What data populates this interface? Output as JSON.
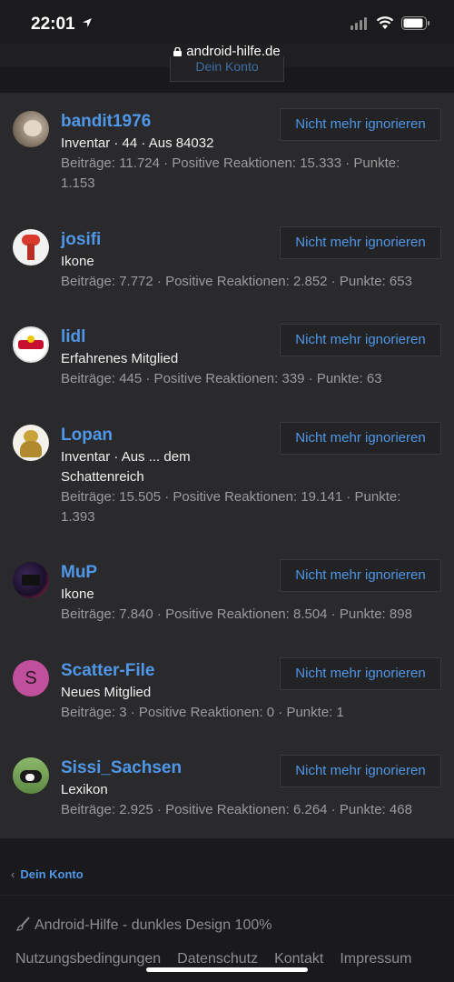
{
  "status_bar": {
    "time": "22:01",
    "url": "android-hilfe.de"
  },
  "top_button": {
    "label": "Dein Konto"
  },
  "ignore_label": "Nicht mehr ignorieren",
  "members": [
    {
      "name": "bandit1976",
      "title": "Inventar · 44 · Aus 84032",
      "stats": "Beiträge: 11.724 · Positive Reaktionen: 15.333 · Punkte: 1.153",
      "avatar": "photo-avatar"
    },
    {
      "name": "josifi",
      "title": "Ikone",
      "stats": "Beiträge: 7.772 · Positive Reaktionen: 2.852 · Punkte: 653",
      "avatar": "photo-avatar"
    },
    {
      "name": "lidl",
      "title": "Erfahrenes Mitglied",
      "stats": "Beiträge: 445 · Positive Reaktionen: 339 · Punkte: 63",
      "avatar": "logo-avatar"
    },
    {
      "name": "Lopan",
      "title": "Inventar · Aus ... dem Schattenreich",
      "stats": "Beiträge: 15.505 · Positive Reaktionen: 19.141 · Punkte: 1.393",
      "avatar": "photo-avatar"
    },
    {
      "name": "MuP",
      "title": "Ikone",
      "stats": "Beiträge: 7.840 · Positive Reaktionen: 8.504 · Punkte: 898",
      "avatar": "photo-avatar"
    },
    {
      "name": "Scatter-File",
      "title": "Neues Mitglied",
      "stats": "Beiträge: 3 · Positive Reaktionen: 0 · Punkte: 1",
      "avatar": "S"
    },
    {
      "name": "Sissi_Sachsen",
      "title": "Lexikon",
      "stats": "Beiträge: 2.925 · Positive Reaktionen: 6.264 · Punkte: 468",
      "avatar": "photo-avatar"
    }
  ],
  "footer": {
    "back_link": "Dein Konto",
    "style": "Android-Hilfe - dunkles Design 100%",
    "links": [
      "Nutzungsbedingungen",
      "Datenschutz",
      "Kontakt",
      "Impressum"
    ]
  },
  "colors": {
    "accent": "#4f97e8",
    "background": "#2a2a2c",
    "footer": "#1a1a1c"
  }
}
